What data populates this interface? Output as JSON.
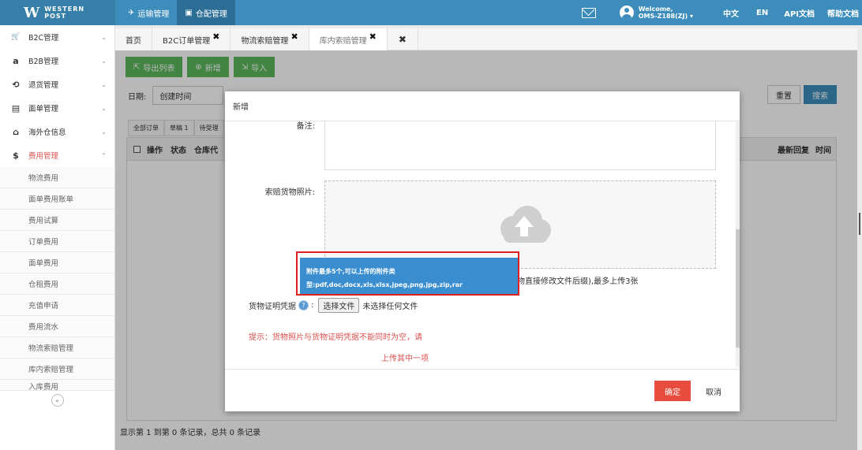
{
  "topbar": {
    "logo_mark": "W",
    "logo_line1": "WESTERN",
    "logo_line2": "POST",
    "nav": [
      {
        "label": "运输管理",
        "icon": "plane-icon"
      },
      {
        "label": "仓配管理",
        "icon": "clipboard-icon"
      }
    ],
    "welcome": "Welcome,",
    "username": "OMS-Z188(ZJ)",
    "lang_cn": "中文",
    "lang_en": "EN",
    "api_docs": "API文档",
    "help_docs": "帮助文档"
  },
  "sidebar": {
    "items": [
      {
        "label": "B2C管理",
        "icon": "cart-icon",
        "glyph": "🛒"
      },
      {
        "label": "B2B管理",
        "icon": "amazon-icon",
        "glyph": "a"
      },
      {
        "label": "退货管理",
        "icon": "return-icon",
        "glyph": "⟲"
      },
      {
        "label": "面单管理",
        "icon": "document-icon",
        "glyph": "▤"
      },
      {
        "label": "海外仓信息",
        "icon": "home-icon",
        "glyph": "⌂"
      },
      {
        "label": "费用管理",
        "icon": "dollar-icon",
        "glyph": "$"
      }
    ],
    "sub_items": [
      "物流费用",
      "面单费用账单",
      "费用试算",
      "订单费用",
      "面单费用",
      "仓租费用",
      "充值申请",
      "费用流水",
      "物流索赔管理",
      "库内索赔管理",
      "入库费用"
    ],
    "collapse": "«"
  },
  "tabs": [
    {
      "label": "首页",
      "closable": false
    },
    {
      "label": "B2C订单管理",
      "closable": true
    },
    {
      "label": "物流索赔管理",
      "closable": true
    },
    {
      "label": "库内索赔管理",
      "closable": true
    }
  ],
  "tab_close_glyph": "✖",
  "main": {
    "toolbar": [
      {
        "label": "导出列表",
        "icon": "export-icon"
      },
      {
        "label": "新增",
        "icon": "plus-circle-icon"
      },
      {
        "label": "导入",
        "icon": "import-icon"
      }
    ],
    "filter": {
      "date_label": "日期:",
      "date_select": "创建时间",
      "reset": "重置",
      "search": "搜索"
    },
    "grid_tabs": [
      "全部订单",
      "草稿 1",
      "待受理"
    ],
    "columns_left": [
      "操作",
      "状态",
      "仓库代"
    ],
    "columns_right": [
      "最新回复",
      "时间"
    ],
    "footer": "显示第 1 到第 0 条记录，总共 0 条记录"
  },
  "modal": {
    "title": "新增",
    "remark_label": "备注:",
    "photo_label": "索赔货物照片:",
    "upload_hint": "物直接修改文件后缀),最多上传3张",
    "proof_label": "货物证明凭据",
    "file_button": "选择文件",
    "file_status": "未选择任何文件",
    "warning_line1": "提示：货物照片与货物证明凭据不能同时为空，请",
    "warning_line2": "上传其中一项",
    "ok": "确定",
    "cancel": "取消"
  },
  "tooltip": {
    "line1": "附件最多5个,可以上传的附件类",
    "line2": "型:pdf,doc,docx,xls,xlsx,jpeg,png,jpg,zip,rar"
  }
}
